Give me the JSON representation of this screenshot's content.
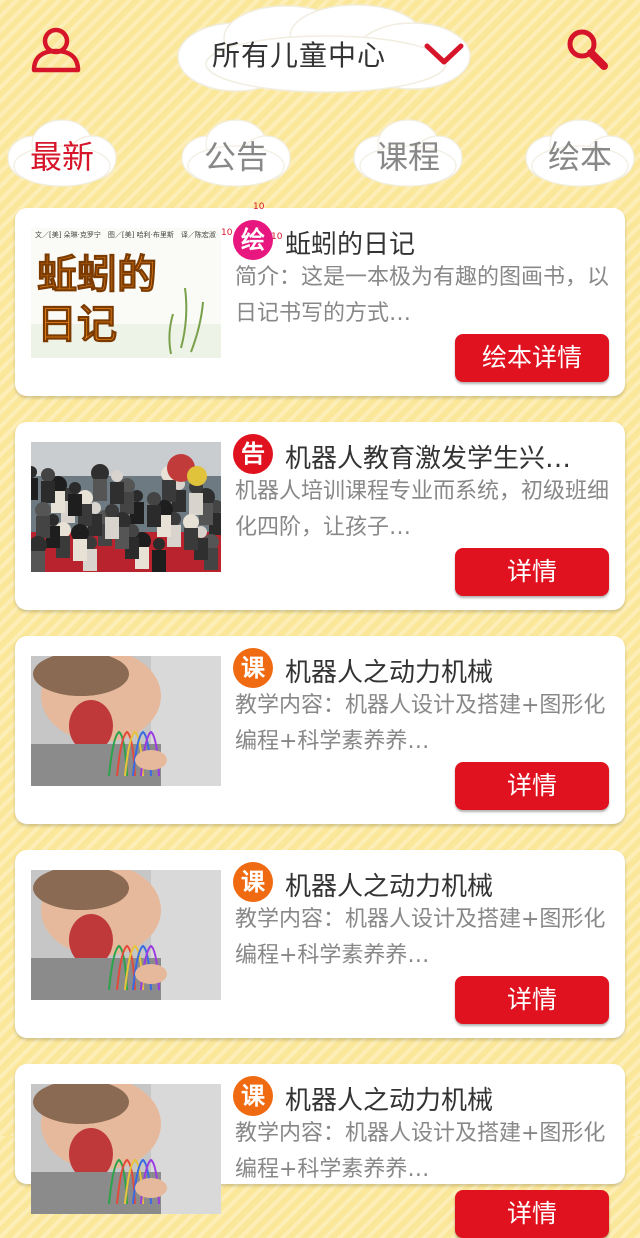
{
  "header": {
    "user_icon": "user-icon",
    "search_icon": "search-icon",
    "center_title": "所有儿童中心",
    "dropdown_icon": "chevron-down-icon"
  },
  "tabs": [
    {
      "label": "最新",
      "active": true
    },
    {
      "label": "公告",
      "active": false
    },
    {
      "label": "课程",
      "active": false
    },
    {
      "label": "绘本",
      "active": false
    }
  ],
  "colors": {
    "accent": "#e0121f",
    "badge_picture_book": "#e8177f",
    "badge_notice": "#e0121f",
    "badge_course": "#f06a12",
    "background": "#fbe79a"
  },
  "cards": [
    {
      "badge": "绘",
      "title": "蚯蚓的日记",
      "desc": "简介：这是一本极为有趣的图画书，以日记书写的方式…",
      "button": "绘本详情",
      "thumb_text": "蚯蚓的日记",
      "thumb_credits": "文／[美] 朵琳·克罗宁　图／[美] 哈利·布里斯　译／陈宏淑",
      "ruler_marks": [
        "10",
        "10",
        "10"
      ]
    },
    {
      "badge": "告",
      "title": "机器人教育激发学生兴…",
      "desc": "机器人培训课程专业而系统，初级班细化四阶，让孩子…",
      "button": "详情"
    },
    {
      "badge": "课",
      "title": "机器人之动力机械",
      "desc": "教学内容：机器人设计及搭建+图形化编程+科学素养养…",
      "button": "详情"
    },
    {
      "badge": "课",
      "title": "机器人之动力机械",
      "desc": "教学内容：机器人设计及搭建+图形化编程+科学素养养…",
      "button": "详情"
    },
    {
      "badge": "课",
      "title": "机器人之动力机械",
      "desc": "教学内容：机器人设计及搭建+图形化编程+科学素养养…",
      "button": "详情"
    }
  ]
}
